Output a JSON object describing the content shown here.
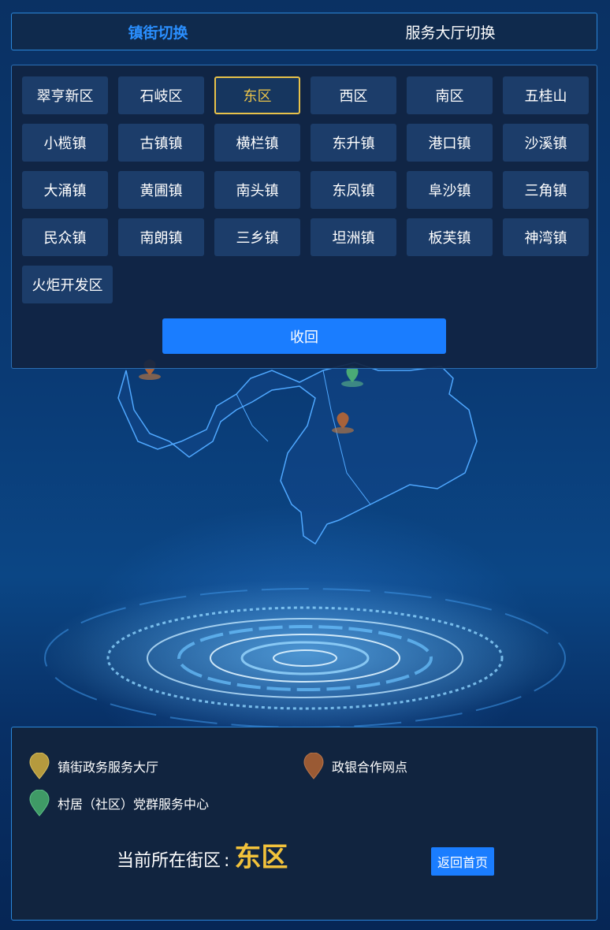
{
  "switch": {
    "tabs": [
      {
        "label": "镇街切换",
        "active": true
      },
      {
        "label": "服务大厅切换",
        "active": false
      }
    ]
  },
  "districts": [
    {
      "label": "翠亨新区"
    },
    {
      "label": "石岐区"
    },
    {
      "label": "东区",
      "active": true
    },
    {
      "label": "西区"
    },
    {
      "label": "南区"
    },
    {
      "label": "五桂山"
    },
    {
      "label": "小榄镇"
    },
    {
      "label": "古镇镇"
    },
    {
      "label": "横栏镇"
    },
    {
      "label": "东升镇"
    },
    {
      "label": "港口镇"
    },
    {
      "label": "沙溪镇"
    },
    {
      "label": "大涌镇"
    },
    {
      "label": "黄圃镇"
    },
    {
      "label": "南头镇"
    },
    {
      "label": "东凤镇"
    },
    {
      "label": "阜沙镇"
    },
    {
      "label": "三角镇"
    },
    {
      "label": "民众镇"
    },
    {
      "label": "南朗镇"
    },
    {
      "label": "三乡镇"
    },
    {
      "label": "坦洲镇"
    },
    {
      "label": "板芙镇"
    },
    {
      "label": "神湾镇"
    },
    {
      "label": "火炬开发区"
    }
  ],
  "collapse_label": "收回",
  "legend": {
    "items": [
      {
        "label": "镇街政务服务大厅",
        "icon": "pin-gold-icon",
        "color": "#b59a3e"
      },
      {
        "label": "政银合作网点",
        "icon": "pin-brown-icon",
        "color": "#9a5a34"
      },
      {
        "label": "村居（社区）党群服务中心",
        "icon": "pin-green-icon",
        "color": "#3f9a66"
      }
    ]
  },
  "current": {
    "prefix": "当前所在街区",
    "colon": ":",
    "value": "东区"
  },
  "home_label": "返回首页",
  "colors": {
    "accent": "#1a7dff",
    "active_tab": "#2a8fff",
    "highlight": "#e8c24a",
    "current_value": "#f2c23b"
  }
}
